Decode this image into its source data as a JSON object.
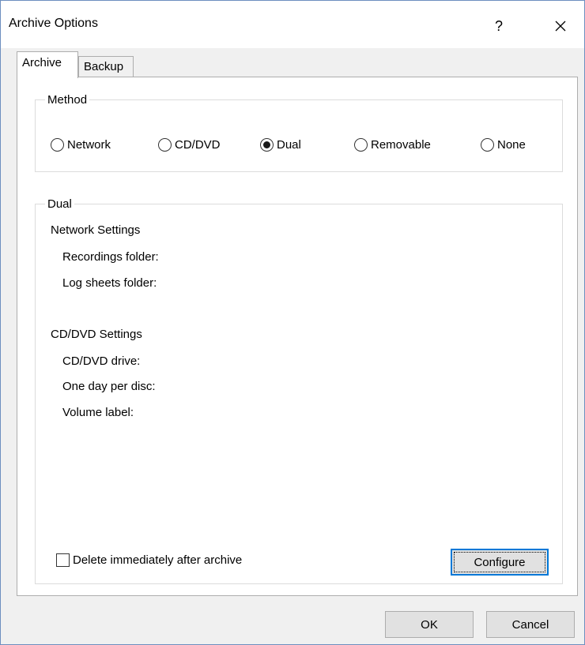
{
  "window": {
    "title": "Archive Options",
    "help_label": "?"
  },
  "tabs": [
    {
      "label": "Archive",
      "active": true
    },
    {
      "label": "Backup",
      "active": false
    }
  ],
  "method": {
    "legend": "Method",
    "options": [
      {
        "label": "Network",
        "selected": false
      },
      {
        "label": "CD/DVD",
        "selected": false
      },
      {
        "label": "Dual",
        "selected": true
      },
      {
        "label": "Removable",
        "selected": false
      },
      {
        "label": "None",
        "selected": false
      }
    ]
  },
  "dual": {
    "legend": "Dual",
    "network_heading": "Network Settings",
    "recordings_folder": "Recordings folder:",
    "log_sheets_folder": "Log sheets folder:",
    "cddvd_heading": "CD/DVD Settings",
    "cddvd_drive": "CD/DVD drive:",
    "one_day_per_disc": "One day per disc:",
    "volume_label": "Volume label:",
    "delete_checkbox_label": "Delete immediately after archive",
    "delete_checked": false,
    "configure_label": "Configure"
  },
  "footer": {
    "ok_label": "OK",
    "cancel_label": "Cancel"
  },
  "colors": {
    "window_border": "#6d8fbf",
    "focus_blue": "#0078d7",
    "dialog_bg": "#f0f0f0"
  }
}
